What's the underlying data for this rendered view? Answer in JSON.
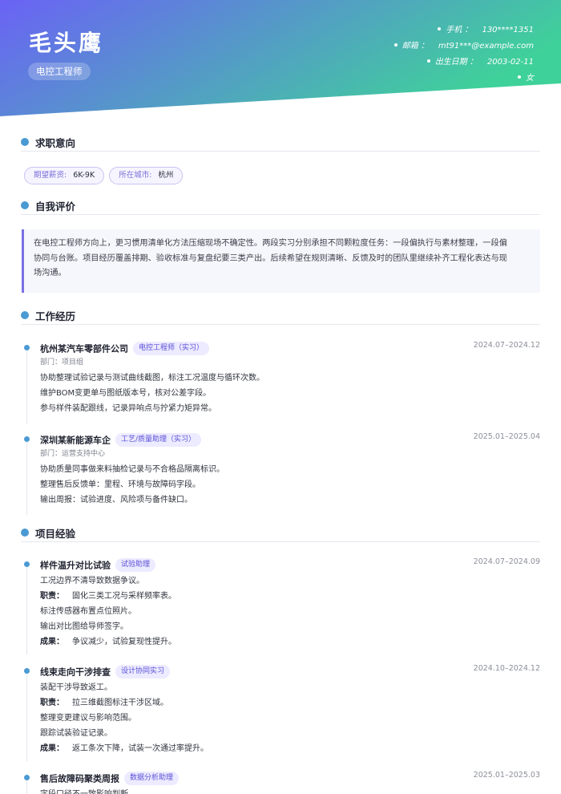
{
  "header": {
    "name": "毛头鹰",
    "title": "电控工程师",
    "contacts": [
      {
        "label": "手机 ：",
        "value": "130****1351"
      },
      {
        "label": "邮箱 ：",
        "value": "mt91***@example.com"
      },
      {
        "label": "出生日期 ：",
        "value": "2003-02-11"
      },
      {
        "label": "",
        "value": "女"
      }
    ],
    "gradient_start": "#6a62f5",
    "gradient_end": "#3fd19a"
  },
  "intent": {
    "heading": "求职意向",
    "salary_label": "期望薪资:",
    "salary_value": "6K-9K",
    "city_label": "所在城市:",
    "city_value": "杭州"
  },
  "summary": {
    "heading": "自我评价",
    "lines": [
      "在电控工程师方向上，更习惯用清单化方法压缩现场不确定性。两段实习分别承担不同颗粒度任务：一段偏执行与素材整理，一段偏",
      "协同与台账。项目经历覆盖排期、验收标准与复盘纪要三类产出。后续希望在规则清晰、反馈及时的团队里继续补齐工程化表达与现",
      "场沟通。"
    ]
  },
  "work": {
    "heading": "工作经历",
    "items": [
      {
        "company": "杭州某汽车零部件公司",
        "role": "电控工程师（实习）",
        "date": "2024.07–2024.12",
        "dept": "部门：项目组",
        "bullets": [
          "协助整理试验记录与测试曲线截图，标注工况温度与循环次数。",
          "维护BOM变更单与图纸版本号，核对公差字段。",
          "参与样件装配跟线，记录异响点与拧紧力矩异常。"
        ]
      },
      {
        "company": "深圳某新能源车企",
        "role": "工艺/质量助理（实习）",
        "date": "2025.01–2025.04",
        "dept": "部门：运营支持中心",
        "bullets": [
          "协助质量同事做来料抽检记录与不合格品隔离标识。",
          "整理售后反馈单：里程、环境与故障码字段。",
          "输出周报：试验进度、风险项与备件缺口。"
        ]
      }
    ]
  },
  "projects": {
    "heading": "项目经验",
    "duty_label": "职责：",
    "result_label": "成果：",
    "items": [
      {
        "name": "样件温升对比试验",
        "tag": "试验助理",
        "date": "2024.07–2024.09",
        "intro": "工况边界不清导致数据争议。",
        "duty": "固化三类工况与采样频率表。",
        "extra": [
          "标注传感器布置点位照片。",
          "输出对比图给导师签字。"
        ],
        "result": "争议减少，试验复现性提升。"
      },
      {
        "name": "线束走向干涉排查",
        "tag": "设计协同实习",
        "date": "2024.10–2024.12",
        "intro": "装配干涉导致返工。",
        "duty": "拉三维截图标注干涉区域。",
        "extra": [
          "整理变更建议与影响范围。",
          "跟踪试装验证记录。"
        ],
        "result": "返工条次下降，试装一次通过率提升。"
      },
      {
        "name": "售后故障码聚类周报",
        "tag": "数据分析助理",
        "date": "2025.01–2025.03",
        "intro": "字段口径不一致影响判断。"
      }
    ]
  }
}
